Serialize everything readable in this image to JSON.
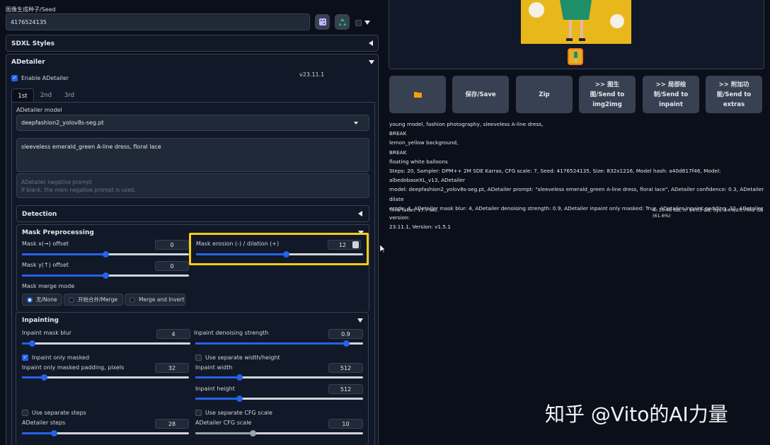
{
  "seed": {
    "label": "图像生成种子/Seed",
    "value": "4176524135"
  },
  "sdxl_styles": {
    "title": "SDXL Styles"
  },
  "adetailer": {
    "title": "ADetailer",
    "enable_label": "Enable ADetailer",
    "version": "v23.11.1",
    "tabs": [
      "1st",
      "2nd",
      "3rd"
    ],
    "model_label": "ADetailer model",
    "model_value": "deepfashion2_yolov8s-seg.pt",
    "prompt": "sleeveless emerald_green A-line dress, floral lace",
    "neg_placeholder_1": "ADetailer negative prompt",
    "neg_placeholder_2": "If blank, the main negative prompt is used.",
    "detection_title": "Detection",
    "mask_preprocessing": {
      "title": "Mask Preprocessing",
      "x_offset_label": "Mask x(→) offset",
      "x_offset": "0",
      "x_offset_level": 0.5,
      "y_offset_label": "Mask y(↑) offset",
      "y_offset": "0",
      "y_offset_level": 0.5,
      "erosion_label": "Mask erosion (-) / dilation (+)",
      "erosion": "12",
      "erosion_level": 0.54,
      "merge_mode_label": "Mask merge mode",
      "merge_options": [
        "无/None",
        "开始合并/Merge",
        "Merge and Invert"
      ]
    },
    "inpainting": {
      "title": "Inpainting",
      "mask_blur_label": "Inpaint mask blur",
      "mask_blur": "4",
      "mask_blur_level": 0.06,
      "denoise_label": "Inpaint denoising strength",
      "denoise": "0.9",
      "denoise_level": 0.9,
      "only_masked_label": "Inpaint only masked",
      "sep_wh_label": "Use separate width/height",
      "padding_label": "Inpaint only masked padding, pixels",
      "padding": "32",
      "padding_level": 0.13,
      "width_label": "Inpaint width",
      "width": "512",
      "width_level": 0.26,
      "height_label": "Inpaint height",
      "height": "512",
      "height_level": 0.26,
      "sep_steps_label": "Use separate steps",
      "sep_cfg_label": "Use separate CFG scale",
      "steps_label": "ADetailer steps",
      "steps": "28",
      "steps_level": 0.19,
      "cfg_label": "ADetailer CFG scale",
      "cfg": "10",
      "cfg_level": 0.34
    }
  },
  "actions": [
    {
      "icon": "folder-icon",
      "label": "📁"
    },
    {
      "label": "保存/Save"
    },
    {
      "label": "Zip"
    },
    {
      "label": ">> 图生\n图/Send to\nimg2img"
    },
    {
      "label": ">> 局部绘\n制/Send to\ninpaint"
    },
    {
      "label": ">> 附加功\n能/Send to\nextras"
    }
  ],
  "info_lines": [
    "young model, fashion photography, sleeveless A-line dress,",
    "BREAK",
    "lemon_yellow background,",
    "BREAK",
    "floating white balloons",
    "Steps: 20, Sampler: DPM++ 2M SDE Karras, CFG scale: 7, Seed: 4176524135, Size: 832x1216, Model hash: a40d817f46, Model: albedobaseXL_v13, ADetailer",
    "model: deepfashion2_yolov8s-seg.pt, ADetailer prompt: \"sleeveless emerald_green A-line dress, floral lace\", ADetailer confidence: 0.3, ADetailer dilate",
    "erode: 4, ADetailer mask blur: 4, ADetailer denoising strength: 0.9, ADetailer inpaint only masked: True, ADetailer inpaint padding: 32, ADetailer version:",
    "23.11.1, Version: v1.5.1"
  ],
  "time_taken": "Time taken: 17.7 sec.",
  "vram": "A: 10.48 GB, R: 14.03 GB, Sys: 14.6/23.7002 GB (61.6%)",
  "watermark": "知乎 @Vito的AI力量",
  "colors": {
    "accent": "#2563eb",
    "highlight": "#facc15",
    "background": "#0b0f19"
  }
}
